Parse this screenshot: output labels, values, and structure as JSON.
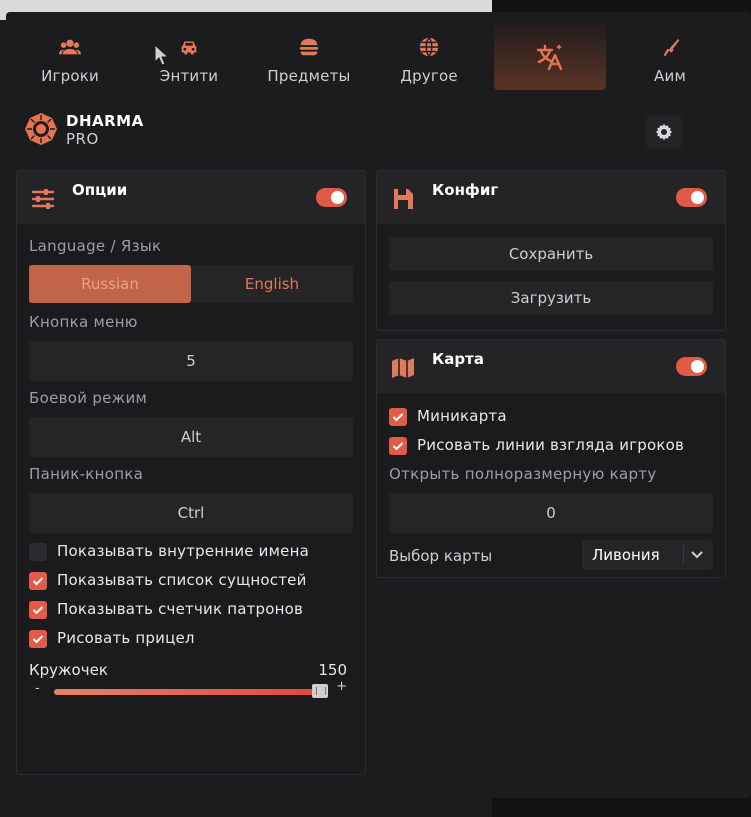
{
  "tabs": [
    {
      "label": "Игроки",
      "icon": "players-icon"
    },
    {
      "label": "Энтити",
      "icon": "car-icon"
    },
    {
      "label": "Предметы",
      "icon": "burger-icon"
    },
    {
      "label": "Другое",
      "icon": "globe-icon"
    },
    {
      "label": "",
      "icon": "translate-icon",
      "active": true
    },
    {
      "label": "Аим",
      "icon": "gun-icon"
    }
  ],
  "brand": {
    "name": "DHARMA",
    "edition": "PRO",
    "logo_icon": "dharma-logo-icon",
    "settings_icon": "gear-icon"
  },
  "options": {
    "title": "Опции",
    "enabled": true,
    "language_label": "Language / Язык",
    "languages": [
      "Russian",
      "English"
    ],
    "selected_language": "Russian",
    "menu_key_label": "Кнопка меню",
    "menu_key_value": "5",
    "combat_mode_label": "Боевой режим",
    "combat_mode_value": "Alt",
    "panic_label": "Паник-кнопка",
    "panic_value": "Ctrl",
    "checkboxes": [
      {
        "label": "Показывать внутренние имена",
        "checked": false
      },
      {
        "label": "Показывать список сущностей",
        "checked": true
      },
      {
        "label": "Показывать счетчик патронов",
        "checked": true
      },
      {
        "label": "Рисовать прицел",
        "checked": true
      }
    ],
    "slider": {
      "label": "Кружочек",
      "value": "150",
      "min_label": "-",
      "max_label": "+",
      "fill_fraction": 0.97
    }
  },
  "config": {
    "title": "Конфиг",
    "enabled": true,
    "save_label": "Сохранить",
    "load_label": "Загрузить"
  },
  "map": {
    "title": "Карта",
    "enabled": true,
    "checkboxes": [
      {
        "label": "Миникарта",
        "checked": true
      },
      {
        "label": "Рисовать линии взгляда игроков",
        "checked": true
      }
    ],
    "fullmap_label": "Открыть полноразмерную карту",
    "fullmap_value": "0",
    "select_label": "Выбор карты",
    "select_value": "Ливония"
  },
  "colors": {
    "accent": "#e25b48",
    "accent_dark": "#5a3226",
    "panel": "#242427",
    "background": "#1c1c1f"
  }
}
